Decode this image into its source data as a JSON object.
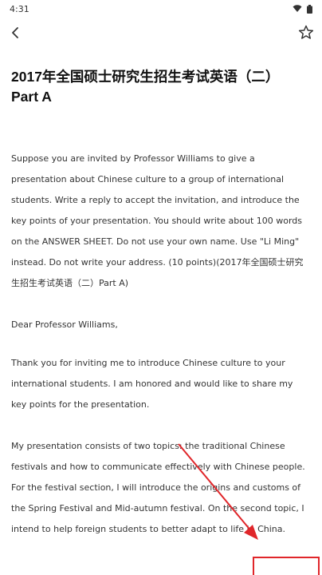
{
  "status_bar": {
    "time": "4:31"
  },
  "article": {
    "title": "2017年全国硕士研究生招生考试英语（二）\nPart A",
    "paragraphs": [
      "Suppose you are invited by Professor Williams to give a\npresentation about Chinese culture to a group of international\nstudents. Write a reply to accept the invitation, and introduce the\nkey points of your presentation. You should write about 100 words\non the ANSWER SHEET. Do not use your own name. Use \"Li Ming\"\ninstead. Do not write your address. (10 points)(2017年全国硕士研究\n生招生考试英语（二）Part A)",
      "Dear Professor Williams,",
      "Thank you for inviting me to introduce Chinese culture to your\ninternational students. I am honored and would like to share my\nkey points for the presentation.",
      "My presentation consists of two topics: the traditional Chinese\nfestivals and how to communicate effectively with Chinese people.\nFor the festival section, I will introduce the origins and customs of\nthe Spring Festival and Mid-autumn festival. On the second topic, I\nintend to help foreign students to better adapt to life in China."
    ]
  },
  "colors": {
    "annotation": "#e0262a",
    "title": "#111111",
    "body": "#333333"
  }
}
